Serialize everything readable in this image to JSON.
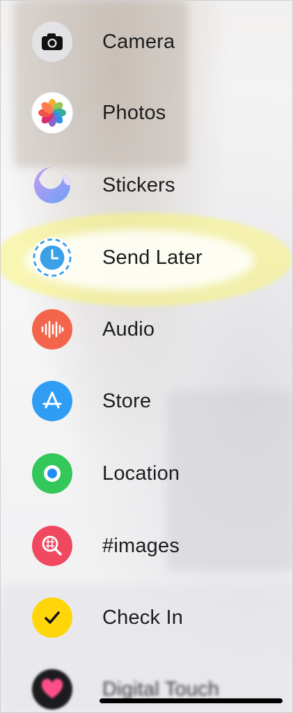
{
  "menu": {
    "items": [
      {
        "label": "Camera",
        "icon": "camera-icon",
        "color": "#e5e5ea"
      },
      {
        "label": "Photos",
        "icon": "photos-icon",
        "color": "#ffffff"
      },
      {
        "label": "Stickers",
        "icon": "stickers-icon",
        "color": "#a88ff0"
      },
      {
        "label": "Send Later",
        "icon": "clock-icon",
        "color": "#3aa0e8"
      },
      {
        "label": "Audio",
        "icon": "audio-waveform-icon",
        "color": "#f2654a"
      },
      {
        "label": "Store",
        "icon": "app-store-icon",
        "color": "#2f9df4"
      },
      {
        "label": "Location",
        "icon": "location-icon",
        "color": "#34c759"
      },
      {
        "label": "#images",
        "icon": "images-search-icon",
        "color": "#f0485f"
      },
      {
        "label": "Check In",
        "icon": "checkmark-icon",
        "color": "#ffd60a"
      },
      {
        "label": "Digital Touch",
        "icon": "digital-touch-icon",
        "color": "#1c1c1e"
      }
    ]
  },
  "highlight_color": "#faf678"
}
